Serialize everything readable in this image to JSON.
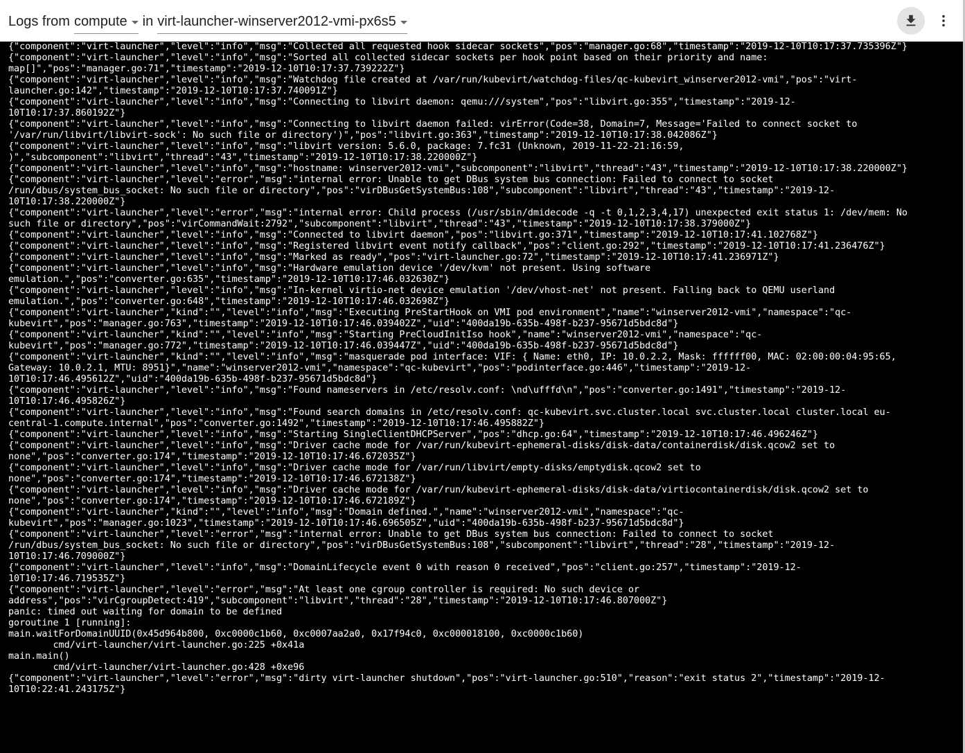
{
  "toolbar": {
    "logs_from_label": "Logs from",
    "container_select": "compute",
    "in_label": "in",
    "pod_select": "virt-launcher-winserver2012-vmi-px6s5",
    "download_icon": "download-icon",
    "more_icon": "more-vert-icon"
  },
  "log_lines": [
    "{\"component\":\"virt-launcher\",\"level\":\"info\",\"msg\":\"Collected all requested hook sidecar sockets\",\"pos\":\"manager.go:68\",\"timestamp\":\"2019-12-10T10:17:37.735396Z\"}",
    "{\"component\":\"virt-launcher\",\"level\":\"info\",\"msg\":\"Sorted all collected sidecar sockets per hook point based on their priority and name:",
    "map[]\",\"pos\":\"manager.go:71\",\"timestamp\":\"2019-12-10T10:17:37.739222Z\"}",
    "{\"component\":\"virt-launcher\",\"level\":\"info\",\"msg\":\"Watchdog file created at /var/run/kubevirt/watchdog-files/qc-kubevirt_winserver2012-vmi\",\"pos\":\"virt-",
    "launcher.go:142\",\"timestamp\":\"2019-12-10T10:17:37.740091Z\"}",
    "{\"component\":\"virt-launcher\",\"level\":\"info\",\"msg\":\"Connecting to libvirt daemon: qemu:///system\",\"pos\":\"libvirt.go:355\",\"timestamp\":\"2019-12-",
    "10T10:17:37.860192Z\"}",
    "{\"component\":\"virt-launcher\",\"level\":\"info\",\"msg\":\"Connecting to libvirt daemon failed: virError(Code=38, Domain=7, Message='Failed to connect socket to",
    "'/var/run/libvirt/libvirt-sock': No such file or directory')\",\"pos\":\"libvirt.go:363\",\"timestamp\":\"2019-12-10T10:17:38.042086Z\"}",
    "{\"component\":\"virt-launcher\",\"level\":\"info\",\"msg\":\"libvirt version: 5.6.0, package: 7.fc31 (Unknown, 2019-11-22-21:16:59,",
    ")\",\"subcomponent\":\"libvirt\",\"thread\":\"43\",\"timestamp\":\"2019-12-10T10:17:38.220000Z\"}",
    "{\"component\":\"virt-launcher\",\"level\":\"info\",\"msg\":\"hostname: winserver2012-vmi\",\"subcomponent\":\"libvirt\",\"thread\":\"43\",\"timestamp\":\"2019-12-10T10:17:38.220000Z\"}",
    "{\"component\":\"virt-launcher\",\"level\":\"error\",\"msg\":\"internal error: Unable to get DBus system bus connection: Failed to connect to socket",
    "/run/dbus/system_bus_socket: No such file or directory\",\"pos\":\"virDBusGetSystemBus:108\",\"subcomponent\":\"libvirt\",\"thread\":\"43\",\"timestamp\":\"2019-12-",
    "10T10:17:38.220000Z\"}",
    "{\"component\":\"virt-launcher\",\"level\":\"error\",\"msg\":\"internal error: Child process (/usr/sbin/dmidecode -q -t 0,1,2,3,4,17) unexpected exit status 1: /dev/mem: No",
    "such file or directory\",\"pos\":\"virCommandWait:2792\",\"subcomponent\":\"libvirt\",\"thread\":\"43\",\"timestamp\":\"2019-12-10T10:17:38.379000Z\"}",
    "{\"component\":\"virt-launcher\",\"level\":\"info\",\"msg\":\"Connected to libvirt daemon\",\"pos\":\"libvirt.go:371\",\"timestamp\":\"2019-12-10T10:17:41.102768Z\"}",
    "{\"component\":\"virt-launcher\",\"level\":\"info\",\"msg\":\"Registered libvirt event notify callback\",\"pos\":\"client.go:292\",\"timestamp\":\"2019-12-10T10:17:41.236476Z\"}",
    "{\"component\":\"virt-launcher\",\"level\":\"info\",\"msg\":\"Marked as ready\",\"pos\":\"virt-launcher.go:72\",\"timestamp\":\"2019-12-10T10:17:41.236971Z\"}",
    "{\"component\":\"virt-launcher\",\"level\":\"info\",\"msg\":\"Hardware emulation device '/dev/kvm' not present. Using software",
    "emulation.\",\"pos\":\"converter.go:635\",\"timestamp\":\"2019-12-10T10:17:46.032630Z\"}",
    "{\"component\":\"virt-launcher\",\"level\":\"info\",\"msg\":\"In-kernel virtio-net device emulation '/dev/vhost-net' not present. Falling back to QEMU userland",
    "emulation.\",\"pos\":\"converter.go:648\",\"timestamp\":\"2019-12-10T10:17:46.032698Z\"}",
    "{\"component\":\"virt-launcher\",\"kind\":\"\",\"level\":\"info\",\"msg\":\"Executing PreStartHook on VMI pod environment\",\"name\":\"winserver2012-vmi\",\"namespace\":\"qc-",
    "kubevirt\",\"pos\":\"manager.go:763\",\"timestamp\":\"2019-12-10T10:17:46.039402Z\",\"uid\":\"400da19b-635b-498f-b237-95671d5bdc8d\"}",
    "{\"component\":\"virt-launcher\",\"kind\":\"\",\"level\":\"info\",\"msg\":\"Starting PreCloudInitIso hook\",\"name\":\"winserver2012-vmi\",\"namespace\":\"qc-",
    "kubevirt\",\"pos\":\"manager.go:772\",\"timestamp\":\"2019-12-10T10:17:46.039447Z\",\"uid\":\"400da19b-635b-498f-b237-95671d5bdc8d\"}",
    "{\"component\":\"virt-launcher\",\"kind\":\"\",\"level\":\"info\",\"msg\":\"masquerade pod interface: VIF: { Name: eth0, IP: 10.0.2.2, Mask: ffffff00, MAC: 02:00:00:04:95:65,",
    "Gateway: 10.0.2.1, MTU: 8951}\",\"name\":\"winserver2012-vmi\",\"namespace\":\"qc-kubevirt\",\"pos\":\"podinterface.go:446\",\"timestamp\":\"2019-12-",
    "10T10:17:46.495612Z\",\"uid\":\"400da19b-635b-498f-b237-95671d5bdc8d\"}",
    "{\"component\":\"virt-launcher\",\"level\":\"info\",\"msg\":\"Found nameservers in /etc/resolv.conf: \\nd\\ufffd\\n\",\"pos\":\"converter.go:1491\",\"timestamp\":\"2019-12-",
    "10T10:17:46.495826Z\"}",
    "{\"component\":\"virt-launcher\",\"level\":\"info\",\"msg\":\"Found search domains in /etc/resolv.conf: qc-kubevirt.svc.cluster.local svc.cluster.local cluster.local eu-",
    "central-1.compute.internal\",\"pos\":\"converter.go:1492\",\"timestamp\":\"2019-12-10T10:17:46.495882Z\"}",
    "{\"component\":\"virt-launcher\",\"level\":\"info\",\"msg\":\"Starting SingleClientDHCPServer\",\"pos\":\"dhcp.go:64\",\"timestamp\":\"2019-12-10T10:17:46.496246Z\"}",
    "{\"component\":\"virt-launcher\",\"level\":\"info\",\"msg\":\"Driver cache mode for /var/run/kubevirt-ephemeral-disks/disk-data/containerdisk/disk.qcow2 set to",
    "none\",\"pos\":\"converter.go:174\",\"timestamp\":\"2019-12-10T10:17:46.672035Z\"}",
    "{\"component\":\"virt-launcher\",\"level\":\"info\",\"msg\":\"Driver cache mode for /var/run/libvirt/empty-disks/emptydisk.qcow2 set to",
    "none\",\"pos\":\"converter.go:174\",\"timestamp\":\"2019-12-10T10:17:46.672138Z\"}",
    "{\"component\":\"virt-launcher\",\"level\":\"info\",\"msg\":\"Driver cache mode for /var/run/kubevirt-ephemeral-disks/disk-data/virtiocontainerdisk/disk.qcow2 set to",
    "none\",\"pos\":\"converter.go:174\",\"timestamp\":\"2019-12-10T10:17:46.672189Z\"}",
    "{\"component\":\"virt-launcher\",\"kind\":\"\",\"level\":\"info\",\"msg\":\"Domain defined.\",\"name\":\"winserver2012-vmi\",\"namespace\":\"qc-",
    "kubevirt\",\"pos\":\"manager.go:1023\",\"timestamp\":\"2019-12-10T10:17:46.696505Z\",\"uid\":\"400da19b-635b-498f-b237-95671d5bdc8d\"}",
    "{\"component\":\"virt-launcher\",\"level\":\"error\",\"msg\":\"internal error: Unable to get DBus system bus connection: Failed to connect to socket",
    "/run/dbus/system_bus_socket: No such file or directory\",\"pos\":\"virDBusGetSystemBus:108\",\"subcomponent\":\"libvirt\",\"thread\":\"28\",\"timestamp\":\"2019-12-",
    "10T10:17:46.709000Z\"}",
    "{\"component\":\"virt-launcher\",\"level\":\"info\",\"msg\":\"DomainLifecycle event 0 with reason 0 received\",\"pos\":\"client.go:257\",\"timestamp\":\"2019-12-",
    "10T10:17:46.719535Z\"}",
    "{\"component\":\"virt-launcher\",\"level\":\"error\",\"msg\":\"At least one cgroup controller is required: No such device or",
    "address\",\"pos\":\"virCgroupDetect:419\",\"subcomponent\":\"libvirt\",\"thread\":\"28\",\"timestamp\":\"2019-12-10T10:17:46.807000Z\"}",
    "panic: timed out waiting for domain to be defined",
    "goroutine 1 [running]:",
    "main.waitForDomainUUID(0x45d964b800, 0xc0000c1b60, 0xc0007aa2a0, 0x17f94c0, 0xc000018100, 0xc0000c1b60)",
    "        cmd/virt-launcher/virt-launcher.go:225 +0x41a",
    "main.main()",
    "        cmd/virt-launcher/virt-launcher.go:428 +0xe96",
    "{\"component\":\"virt-launcher\",\"level\":\"error\",\"msg\":\"dirty virt-launcher shutdown\",\"pos\":\"virt-launcher.go:510\",\"reason\":\"exit status 2\",\"timestamp\":\"2019-12-",
    "10T10:22:41.243175Z\"}"
  ]
}
